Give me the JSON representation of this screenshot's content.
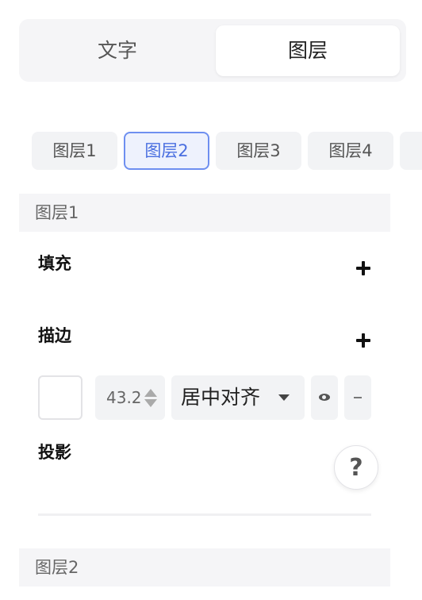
{
  "tabs": [
    {
      "label": "文字",
      "active": false
    },
    {
      "label": "图层",
      "active": true
    }
  ],
  "layer_chips": [
    {
      "label": "图层1",
      "active": false
    },
    {
      "label": "图层2",
      "active": true
    },
    {
      "label": "图层3",
      "active": false
    },
    {
      "label": "图层4",
      "active": false
    }
  ],
  "layer1": {
    "header": "图层1",
    "fill_label": "填充",
    "stroke_label": "描边",
    "stroke": {
      "width_value": "43.2",
      "align_value": "居中对齐"
    },
    "shadow_label": "投影"
  },
  "layer2": {
    "header": "图层2"
  },
  "help_label": "?",
  "colors": {
    "accent": "#6e8ff0",
    "panel_bg": "#f5f5f7"
  }
}
